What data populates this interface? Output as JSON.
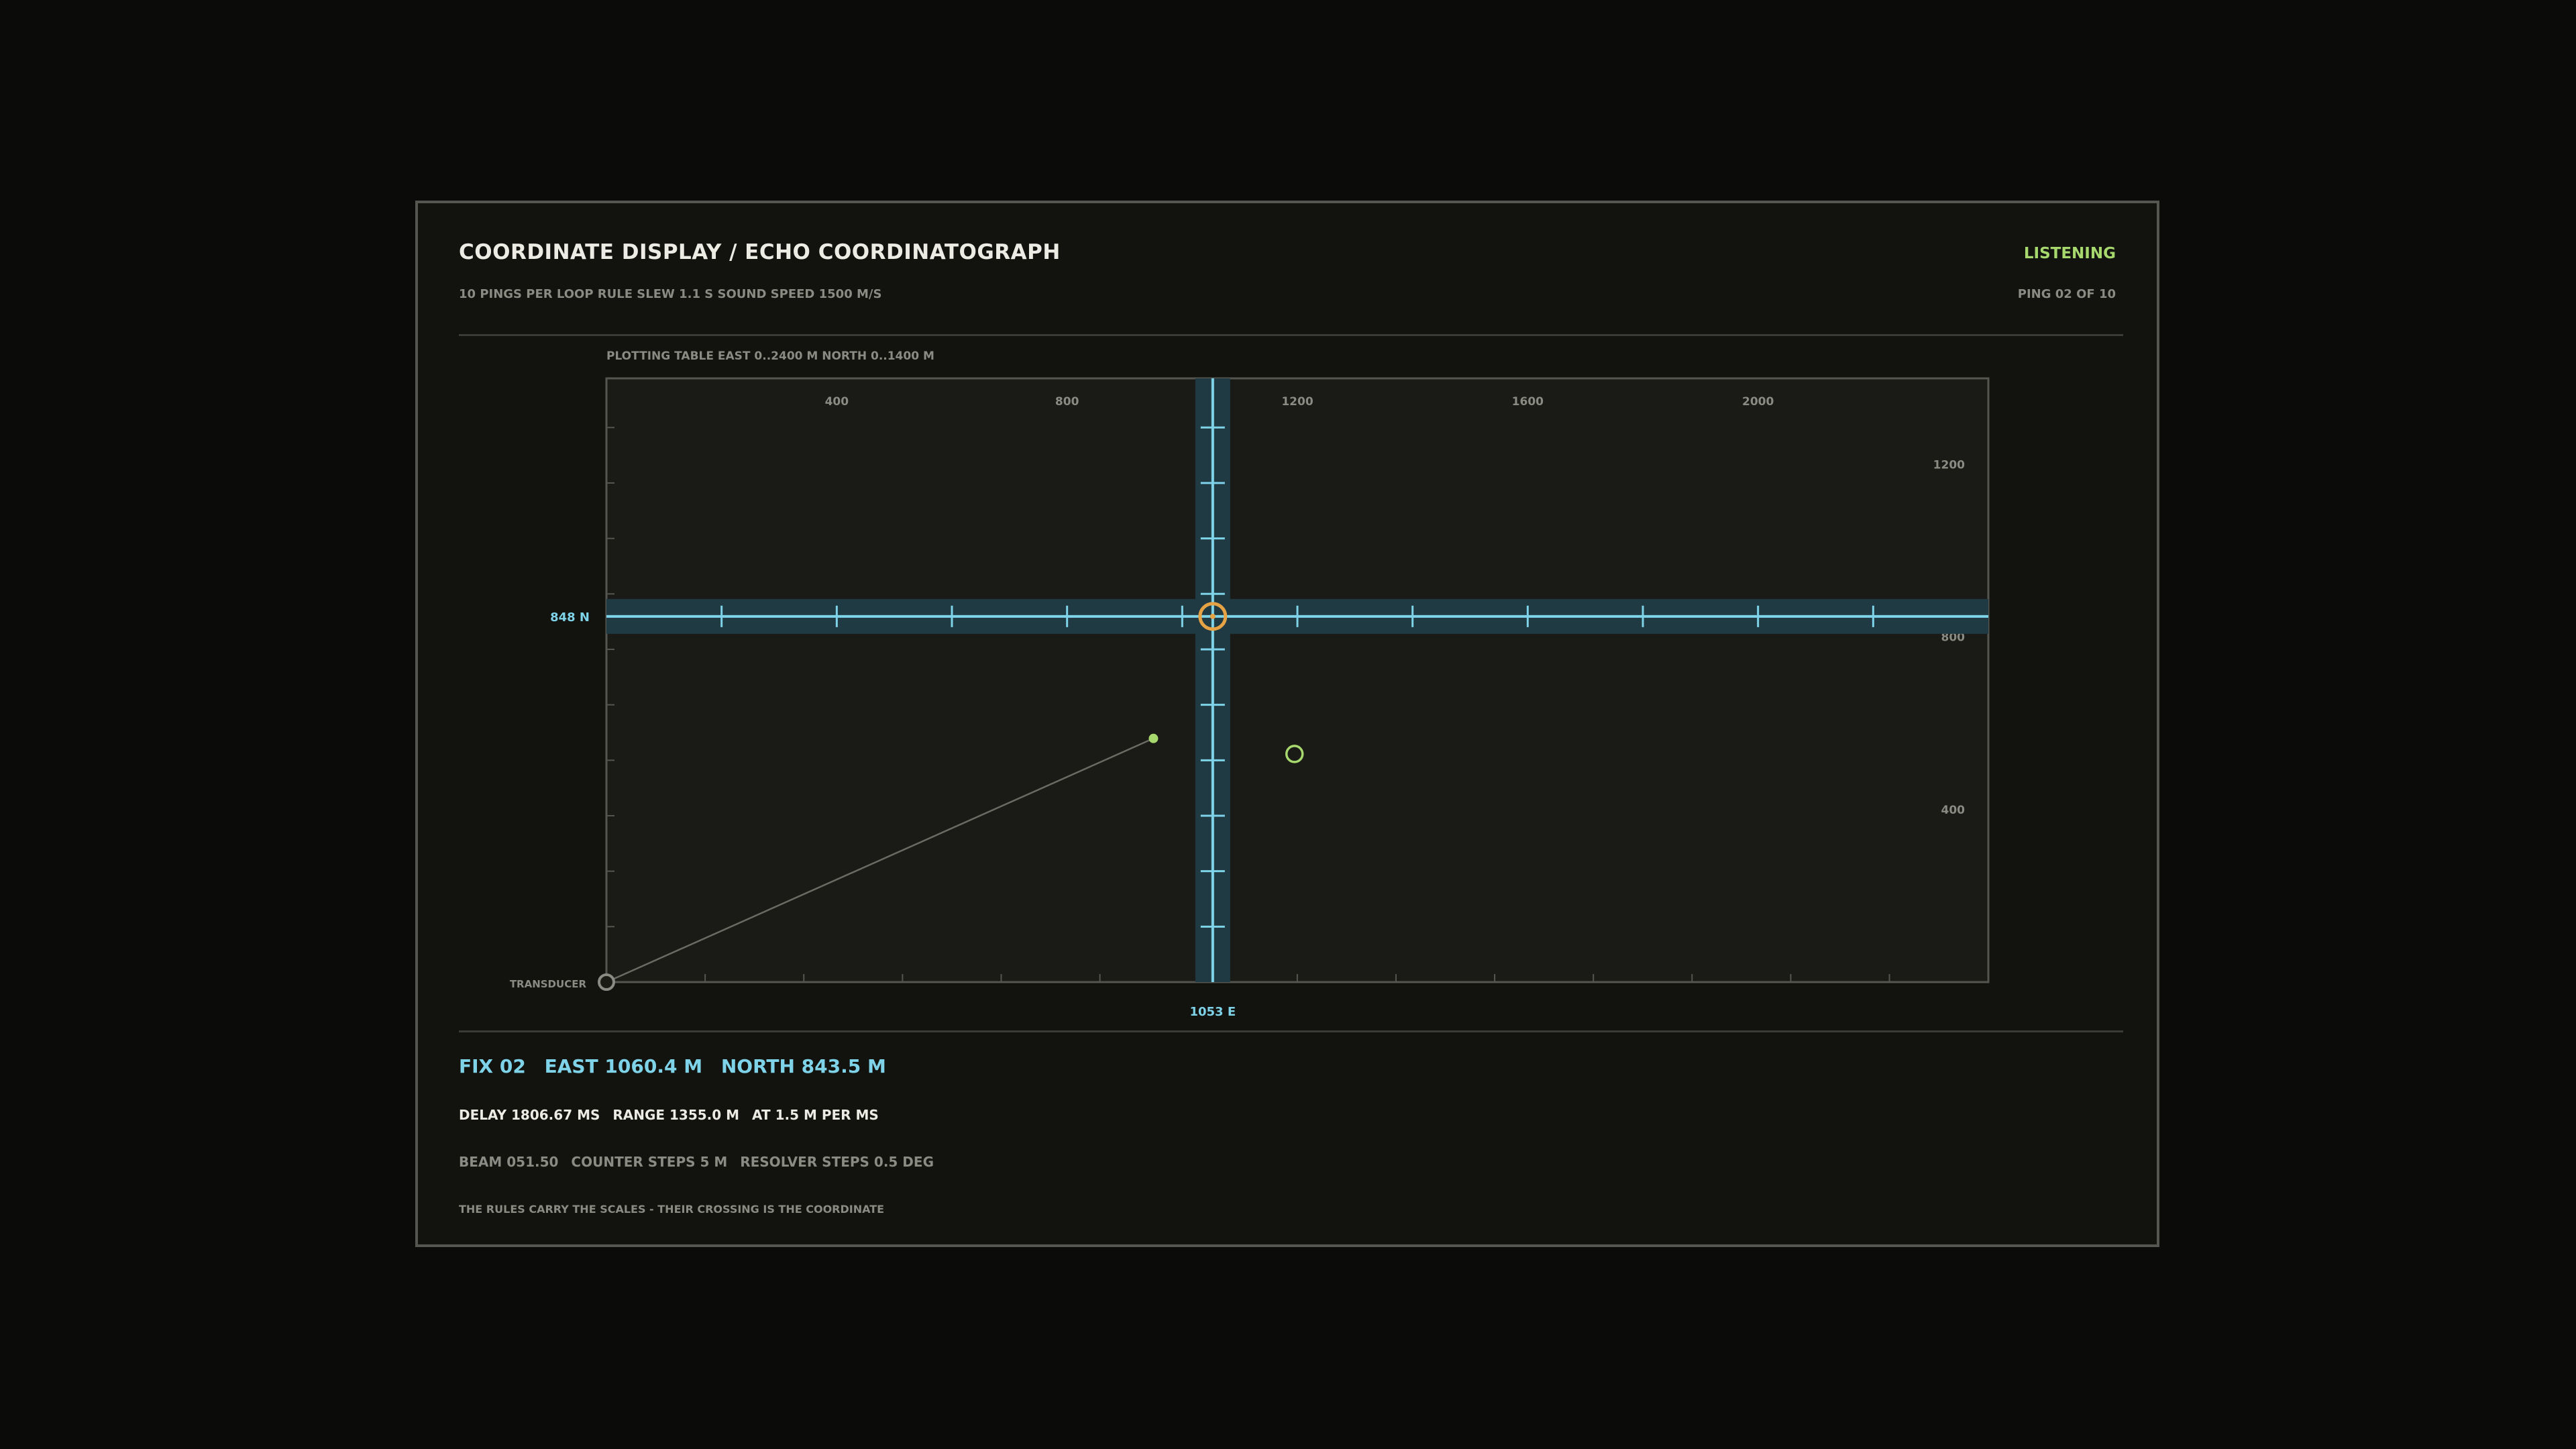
{
  "header": {
    "title": "COORDINATE DISPLAY / ECHO COORDINATOGRAPH",
    "subtitle": "10 PINGS PER LOOP   RULE SLEW 1.1 S   SOUND SPEED 1500 M/S",
    "status": "LISTENING",
    "ping": "PING 02 OF 10"
  },
  "plot": {
    "caption": "PLOTTING TABLE   EAST 0..2400 M   NORTH 0..1400 M",
    "east_range": [
      0,
      2400
    ],
    "north_range": [
      0,
      1400
    ],
    "east_tick_labels": [
      "400",
      "800",
      "1200",
      "1600",
      "2000"
    ],
    "north_tick_labels": [
      "1200",
      "800",
      "400"
    ],
    "rule_east_label": "1053 E",
    "rule_north_label": "848 N",
    "rule_east_value": 1053,
    "rule_north_value": 848,
    "transducer_label": "TRANSDUCER",
    "echo_fix": {
      "east": 950,
      "north": 565
    },
    "target_marker": {
      "east": 1195,
      "north": 529
    },
    "colors": {
      "rule": "#7fd3e8",
      "rule_band": "#1f3a42",
      "crossing": "#e6a345",
      "fix": "#a6d86e",
      "grid": "#55564f"
    }
  },
  "readout": {
    "fix": "FIX 02",
    "east": "EAST  1060.4 M",
    "north": "NORTH  843.5 M",
    "delay": "DELAY 1806.67 MS",
    "range": "RANGE  1355.0 M",
    "at": "AT  1.5 M PER MS",
    "beam": "BEAM 051.50",
    "counter": "COUNTER STEPS 5 M",
    "resolver": "RESOLVER STEPS 0.5 DEG",
    "footnote": "THE RULES CARRY THE SCALES - THEIR CROSSING IS THE COORDINATE"
  }
}
